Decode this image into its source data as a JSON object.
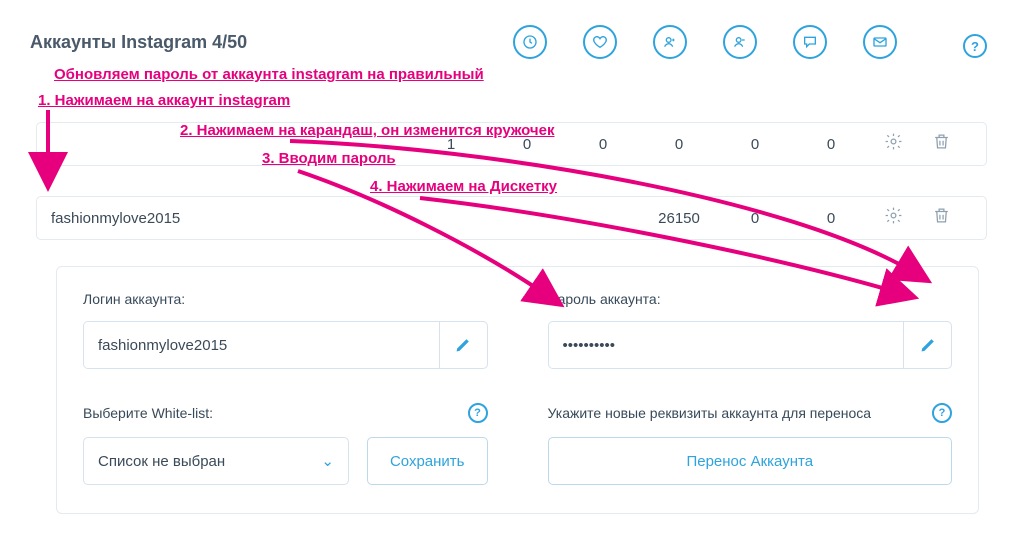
{
  "header": {
    "title": "Аккаунты Instagram 4/50"
  },
  "annotations": {
    "top": "Обновляем пароль от аккаунта instagram  на правильный",
    "s1": "1. Нажимаем на аккаунт instagram",
    "s2": "2. Нажимаем на карандаш, он изменится кружочек",
    "s3": "3. Вводим пароль",
    "s4": "4. Нажимаем на Дискетку"
  },
  "rows": [
    {
      "name": "",
      "c1": "1",
      "c2": "0",
      "c3": "0",
      "c4": "0",
      "c5": "0",
      "c6": "0"
    },
    {
      "name": "fashionmylove2015",
      "c1": "",
      "c2": "",
      "c3": "",
      "c4": "26150",
      "c5": "0",
      "c6": "0"
    }
  ],
  "panel": {
    "login_label": "Логин аккаунта:",
    "login_value": "fashionmylove2015",
    "password_label": "Пароль аккаунта:",
    "password_value": "••••••••••",
    "whitelist_label": "Выберите White-list:",
    "whitelist_selected": "Список не выбран",
    "save_label": "Сохранить",
    "transfer_label": "Укажите новые реквизиты аккаунта для переноса",
    "transfer_btn": "Перенос Аккаунта"
  }
}
